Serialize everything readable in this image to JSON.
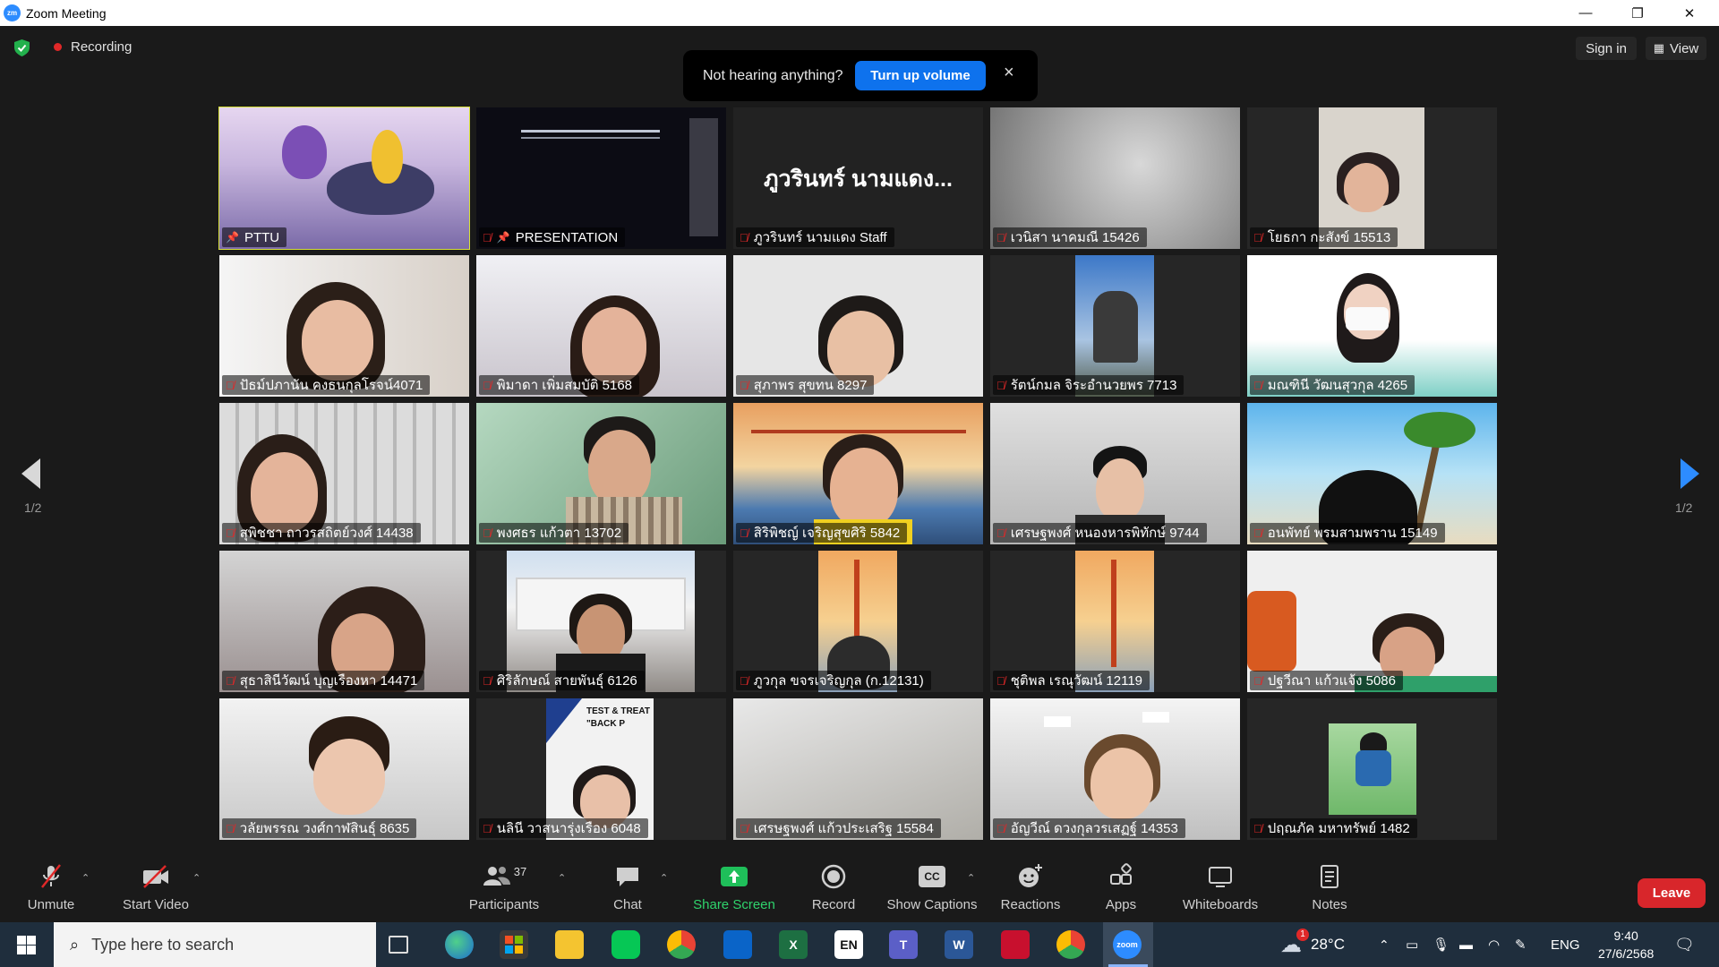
{
  "window": {
    "title": "Zoom Meeting",
    "logo": "zm",
    "minimize": "—",
    "restore": "❐",
    "close": "✕"
  },
  "meeting": {
    "recording_label": "Recording",
    "sign_in": "Sign in",
    "view": "View"
  },
  "toast": {
    "message": "Not hearing anything?",
    "button": "Turn up volume",
    "close": "×"
  },
  "pager": {
    "left": "1/2",
    "right": "1/2"
  },
  "tiles": [
    {
      "name": "PTTU",
      "pinned": true,
      "muted": false,
      "active": true
    },
    {
      "name": "PRESENTATION",
      "pinned": true,
      "muted": true
    },
    {
      "name": "ภูวรินทร์ นามแดง Staff",
      "muted": true,
      "big_name": "ภูวรินทร์ นามแดง..."
    },
    {
      "name": "เวนิสา นาคมณี 15426",
      "muted": true
    },
    {
      "name": "โยธกา กะสังข์ 15513",
      "muted": true
    },
    {
      "name": "ปัธม์ปภานัน คงธนกุลโรจน์4071",
      "muted": true
    },
    {
      "name": "พิมาดา เพิ่มสมบัติ 5168",
      "muted": true
    },
    {
      "name": "สุภาพร สุขทน 8297",
      "muted": true
    },
    {
      "name": "รัตน์กมล จิระอำนวยพร 7713",
      "muted": true
    },
    {
      "name": "มณฑินี วัฒนสุวกุล 4265",
      "muted": true
    },
    {
      "name": "สุพิชชา ถาวรสถิตย์วงศ์ 14438",
      "muted": true
    },
    {
      "name": "พงศธร แก้วตา 13702",
      "muted": true
    },
    {
      "name": "สิริพิชญ์ เจริญสุขศิริ 5842",
      "muted": true
    },
    {
      "name": "เศรษฐพงศ์ หนองหารพิทักษ์ 9744",
      "muted": true
    },
    {
      "name": "อนพัทย์ พรมสามพราน 15149",
      "muted": true
    },
    {
      "name": "สุธาสินีวัฒน์ บุญเรืองหา 14471",
      "muted": true
    },
    {
      "name": "ศิริลักษณ์ สายพันธุ์ 6126",
      "muted": true
    },
    {
      "name": "ภูวกุล ขจรเจริญกุล (ก.12131)",
      "muted": true
    },
    {
      "name": "ชุติพล เรณุวัฒน์ 12119",
      "muted": true
    },
    {
      "name": "ปฐวีณา แก้วแจ้ง 5086",
      "muted": true
    },
    {
      "name": "วลัยพรรณ วงศ์กาฬสินธุ์ 8635",
      "muted": true
    },
    {
      "name": "นลินี วาสนารุ่งเรือง 6048",
      "muted": true,
      "poster_text": "TEST & TREAT \"BACK P"
    },
    {
      "name": "เศรษฐพงศ์ แก้วประเสริฐ 15584",
      "muted": true
    },
    {
      "name": "อัญวีณ์ ดวงกุลวรเสฏฐ์ 14353",
      "muted": true
    },
    {
      "name": "ปฤณภัค มหาทรัพย์ 1482",
      "muted": true
    }
  ],
  "toolbar": {
    "unmute": "Unmute",
    "start_video": "Start Video",
    "participants": "Participants",
    "participants_count": "37",
    "chat": "Chat",
    "share_screen": "Share Screen",
    "record": "Record",
    "show_captions": "Show Captions",
    "captions_icon": "CC",
    "reactions": "Reactions",
    "apps": "Apps",
    "whiteboards": "Whiteboards",
    "notes": "Notes",
    "leave": "Leave"
  },
  "taskbar": {
    "search_placeholder": "Type here to search",
    "en_icon": "EN",
    "weather_badge": "1",
    "temperature": "28°C",
    "language": "ENG",
    "time": "9:40",
    "date": "27/6/2568",
    "zoom_icon": "zoom",
    "excel_icon": "X",
    "word_icon": "W",
    "teams_icon": "T"
  },
  "colors": {
    "accent_blue": "#0e72ed",
    "leave_red": "#d8262b",
    "share_green": "#1fbf5a",
    "active_outline": "#d8e23a",
    "mute_red": "#e02828"
  }
}
